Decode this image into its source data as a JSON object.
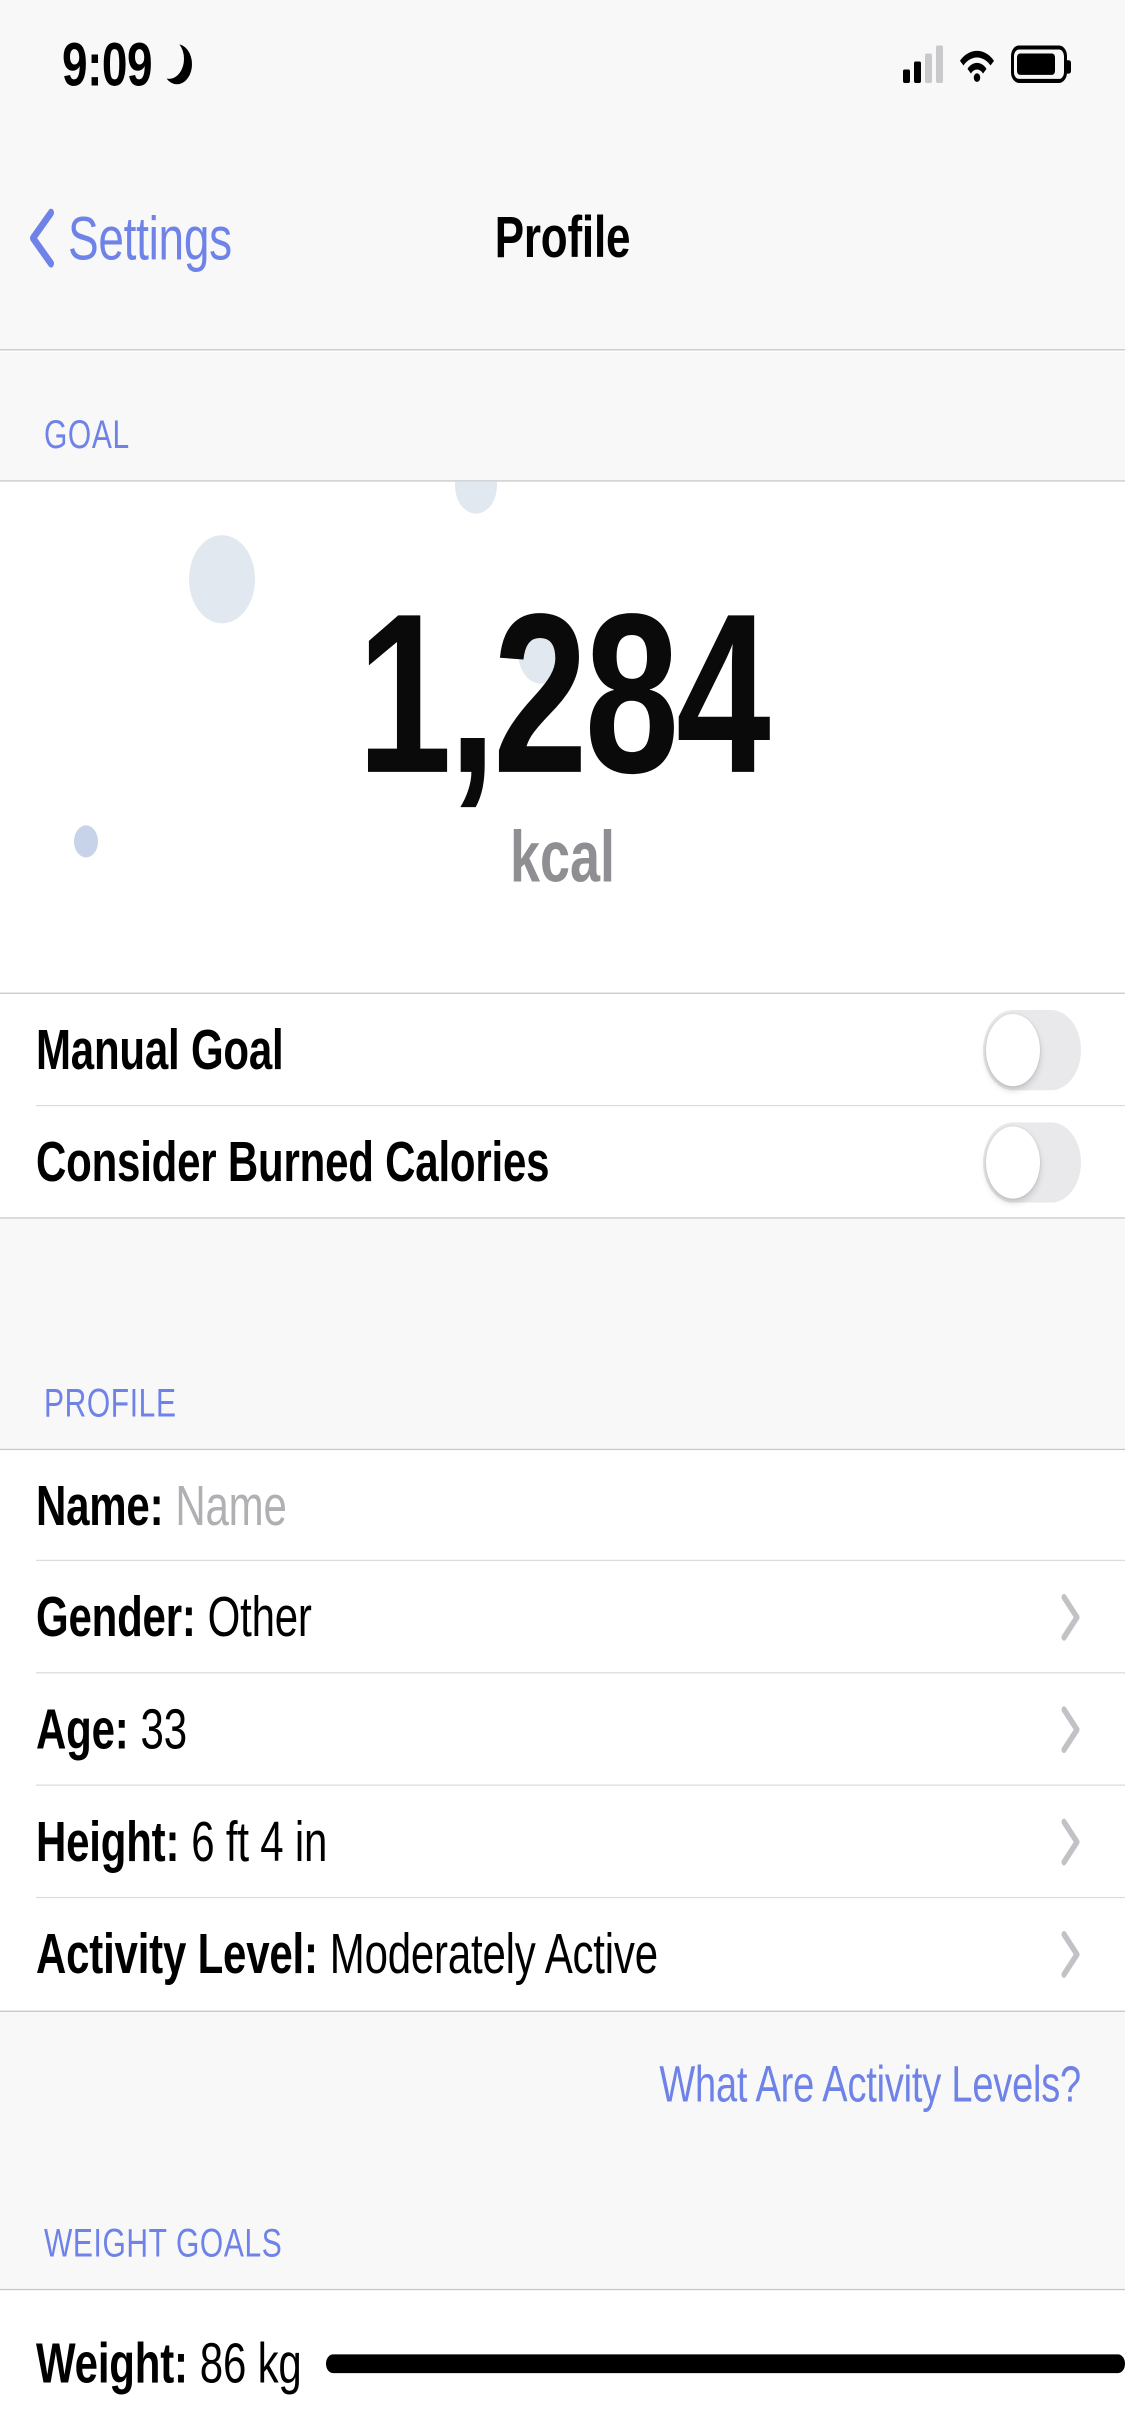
{
  "status_bar": {
    "time": "9:09",
    "dnd_icon": "crescent-moon-icon",
    "signal_icon": "cellular-signal-icon",
    "wifi_icon": "wifi-icon",
    "battery_icon": "battery-icon"
  },
  "nav": {
    "back_label": "Settings",
    "back_icon": "chevron-left-icon",
    "title": "Profile"
  },
  "goal_section": {
    "header": "GOAL",
    "value": "1,284",
    "unit": "kcal",
    "bubble_color": "#e2e8f0",
    "rows": [
      {
        "label": "Manual Goal",
        "toggle": "off"
      },
      {
        "label": "Consider Burned Calories",
        "toggle": "off"
      }
    ]
  },
  "profile_section": {
    "header": "PROFILE",
    "rows": [
      {
        "label": "Name:",
        "value": "Name",
        "is_placeholder": true,
        "chevron": false
      },
      {
        "label": "Gender:",
        "value": "Other",
        "is_placeholder": false,
        "chevron": true
      },
      {
        "label": "Age:",
        "value": "33",
        "is_placeholder": false,
        "chevron": true
      },
      {
        "label": "Height:",
        "value": "6 ft 4 in",
        "is_placeholder": false,
        "chevron": true
      },
      {
        "label": "Activity Level:",
        "value": "Moderately Active",
        "is_placeholder": false,
        "chevron": true
      }
    ],
    "footer_link": "What Are Activity Levels?"
  },
  "weight_section": {
    "header": "WEIGHT GOALS",
    "row": {
      "label": "Weight:",
      "value": "86 kg"
    }
  },
  "colors": {
    "accent": "#6e82e8",
    "group_bg": "#f8f8f8",
    "separator": "#c8c8cc",
    "muted_text": "#8e8e93"
  }
}
